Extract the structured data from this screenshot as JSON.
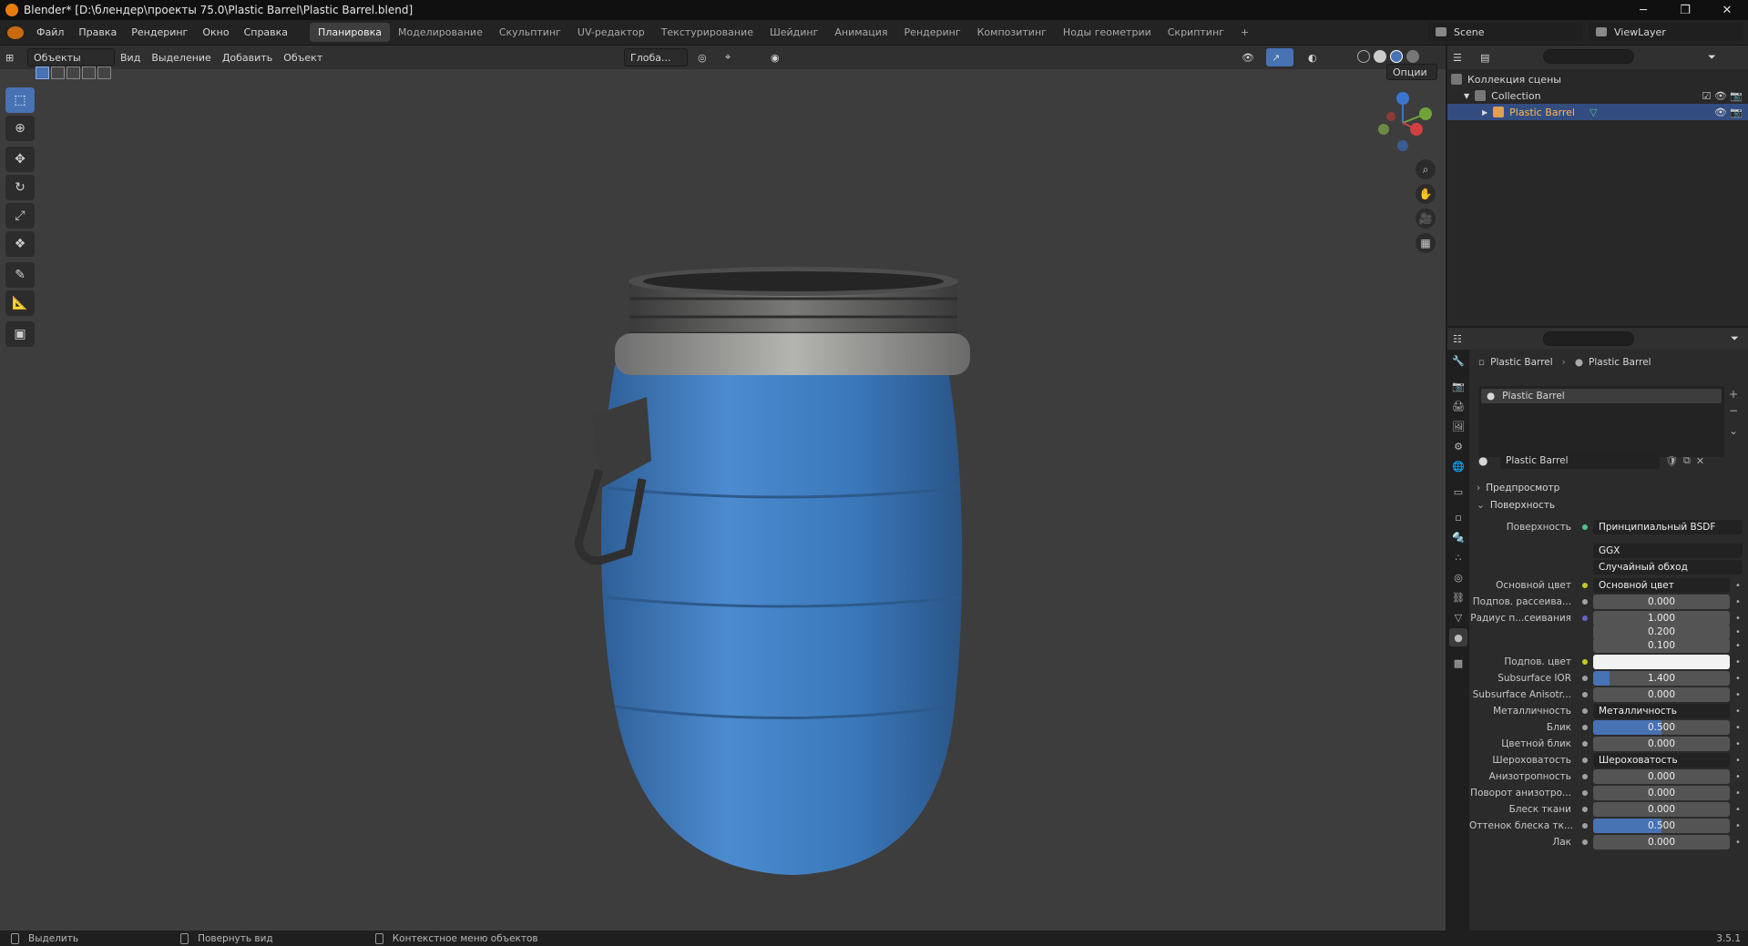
{
  "title": "Blender* [D:\\блендер\\проекты 75.0\\Plastic Barrel\\Plastic Barrel.blend]",
  "window_buttons": {
    "minimize": "─",
    "maximize": "❐",
    "close": "✕"
  },
  "menu": [
    "Файл",
    "Правка",
    "Рендеринг",
    "Окно",
    "Справка"
  ],
  "workspaces": [
    "Планировка",
    "Моделирование",
    "Скульптинг",
    "UV-редактор",
    "Текстурирование",
    "Шейдинг",
    "Анимация",
    "Рендеринг",
    "Композитинг",
    "Ноды геометрии",
    "Скриптинг",
    "+"
  ],
  "active_workspace": "Планировка",
  "scene": "Scene",
  "view_layer": "ViewLayer",
  "viewport": {
    "mode": "Объекты",
    "menus": [
      "Вид",
      "Выделение",
      "Добавить",
      "Объект"
    ],
    "transform_orientation": "Глоба...",
    "options": "Опции",
    "barrel_color": "#3e7bbd"
  },
  "outliner": {
    "search_placeholder": "",
    "rows": [
      {
        "label": "Коллекция сцены"
      },
      {
        "label": "Collection"
      },
      {
        "label": "Plastic Barrel"
      }
    ]
  },
  "properties": {
    "breadcrumb": [
      "Plastic Barrel",
      "Plastic Barrel"
    ],
    "slot": "Plastic Barrel",
    "material_name": "Plastic Barrel",
    "panels": {
      "preview": "Предпросмотр",
      "surface": "Поверхность"
    },
    "surface_label": "Поверхность",
    "surface_value": "Принципиальный BSDF",
    "distribution": "GGX",
    "subsurface_method": "Случайный обход",
    "rows": [
      {
        "label": "Основной цвет",
        "value": "Основной цвет",
        "kind": "link",
        "sock": "#c7c729"
      },
      {
        "label": "Подпов. рассеива...",
        "value": "0.000",
        "kind": "num",
        "sock": "#a1a1a1",
        "fill": 0
      },
      {
        "label": "Радиус п...сеивания",
        "value": "1.000",
        "kind": "num",
        "sock": "#6363c7",
        "fill": 0
      },
      {
        "label": "",
        "value": "0.200",
        "kind": "num",
        "sock": "",
        "fill": 0
      },
      {
        "label": "",
        "value": "0.100",
        "kind": "num",
        "sock": "",
        "fill": 0
      },
      {
        "label": "Подпов. цвет",
        "value": "",
        "kind": "color",
        "sock": "#c7c729",
        "fill": 0
      },
      {
        "label": "Subsurface IOR",
        "value": "1.400",
        "kind": "num",
        "sock": "#a1a1a1",
        "fill": 0.12
      },
      {
        "label": "Subsurface Anisotr...",
        "value": "0.000",
        "kind": "num",
        "sock": "#a1a1a1",
        "fill": 0
      },
      {
        "label": "Металличность",
        "value": "Металличность",
        "kind": "link",
        "sock": "#a1a1a1"
      },
      {
        "label": "Блик",
        "value": "0.500",
        "kind": "num",
        "sock": "#a1a1a1",
        "fill": 0.5
      },
      {
        "label": "Цветной блик",
        "value": "0.000",
        "kind": "num",
        "sock": "#a1a1a1",
        "fill": 0
      },
      {
        "label": "Шероховатость",
        "value": "Шероховатость",
        "kind": "link",
        "sock": "#a1a1a1"
      },
      {
        "label": "Анизотропность",
        "value": "0.000",
        "kind": "num",
        "sock": "#a1a1a1",
        "fill": 0
      },
      {
        "label": "Поворот анизотро...",
        "value": "0.000",
        "kind": "num",
        "sock": "#a1a1a1",
        "fill": 0
      },
      {
        "label": "Блеск ткани",
        "value": "0.000",
        "kind": "num",
        "sock": "#a1a1a1",
        "fill": 0
      },
      {
        "label": "Оттенок блеска тк...",
        "value": "0.500",
        "kind": "num",
        "sock": "#a1a1a1",
        "fill": 0.5
      },
      {
        "label": "Лак",
        "value": "0.000",
        "kind": "num",
        "sock": "#a1a1a1",
        "fill": 0
      }
    ]
  },
  "status": {
    "items": [
      "Выделить",
      "Повернуть вид",
      "Контекстное меню объектов"
    ],
    "version": "3.5.1"
  }
}
